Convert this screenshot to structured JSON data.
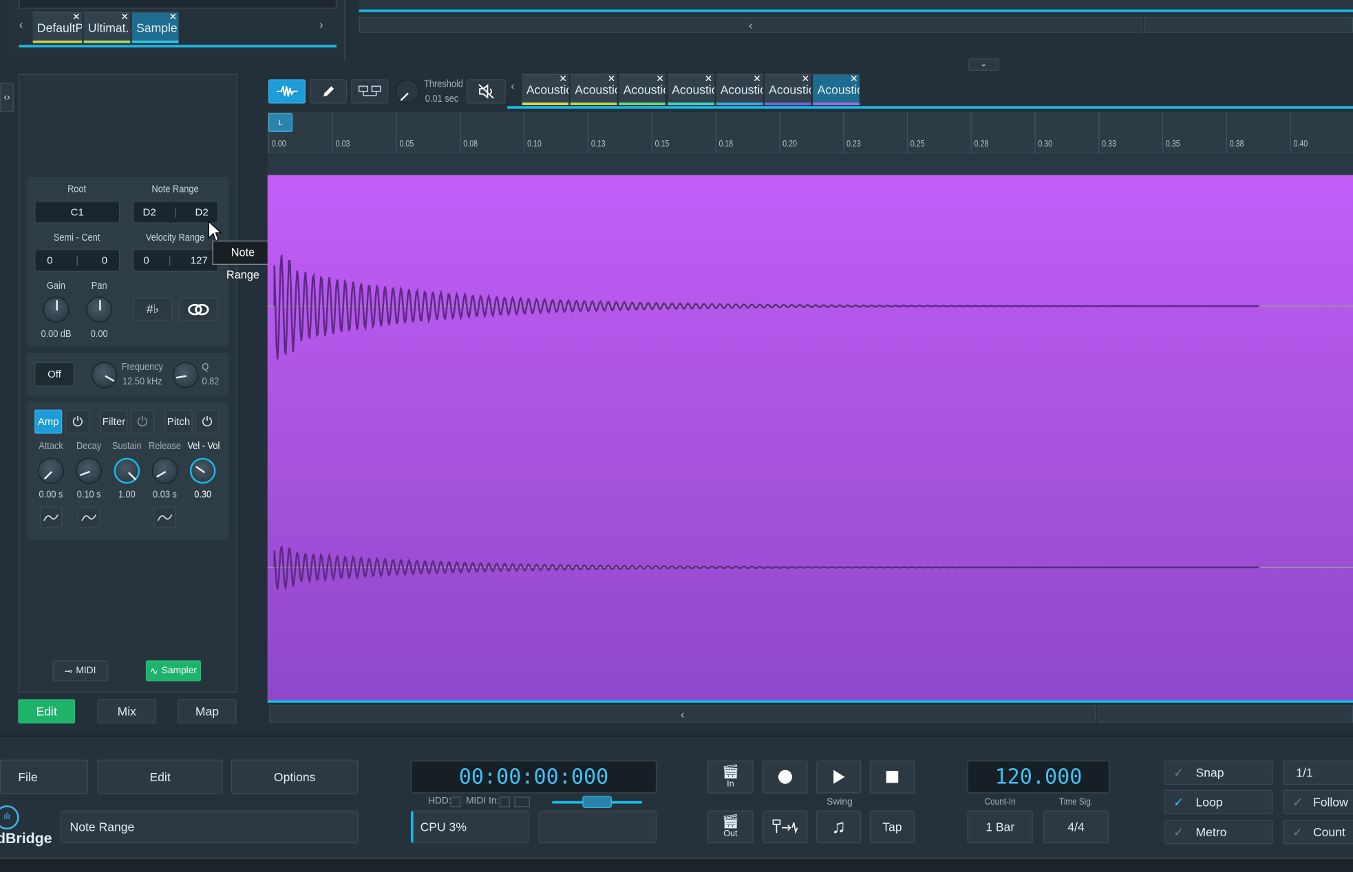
{
  "browser_tabs": [
    {
      "label": "DefaultP...",
      "color": "#c5d44a"
    },
    {
      "label": "Ultimat...",
      "color": "#a7d86a"
    },
    {
      "label": "Sample",
      "color": "#2fc2e8"
    }
  ],
  "toolbar": {
    "threshold_label": "Threshold",
    "threshold_value": "0.01 sec"
  },
  "sample_tabs": [
    {
      "label": "Acoustic...",
      "color": "#d8d64a"
    },
    {
      "label": "Acoustic...",
      "color": "#b6d84a"
    },
    {
      "label": "Acoustic...",
      "color": "#6ad87a"
    },
    {
      "label": "Acoustic...",
      "color": "#3fd8c6"
    },
    {
      "label": "Acoustic...",
      "color": "#3fa8e8"
    },
    {
      "label": "Acoustic...",
      "color": "#6a6ae8"
    },
    {
      "label": "Acoustic...",
      "color": "#a06ae8"
    }
  ],
  "ruler": {
    "loop_marker": "L",
    "ticks": [
      "0.00",
      "0.03",
      "0.05",
      "0.08",
      "0.10",
      "0.13",
      "0.15",
      "0.18",
      "0.20",
      "0.23",
      "0.25",
      "0.28",
      "0.30",
      "0.33",
      "0.35",
      "0.38",
      "0.40"
    ]
  },
  "zone": {
    "root_label": "Root",
    "root_value": "C1",
    "note_range_label": "Note Range",
    "note_low": "D2",
    "note_high": "D2",
    "semi_cent_label": "Semi - Cent",
    "semi": "0",
    "cent": "0",
    "velocity_label": "Velocity Range",
    "vel_low": "0",
    "vel_high": "127",
    "gain_label": "Gain",
    "gain_value": "0.00 dB",
    "pan_label": "Pan",
    "pan_value": "0.00",
    "sharp_flat_symbol": "#♭"
  },
  "tooltip": "Note Range",
  "filter": {
    "off_label": "Off",
    "freq_label": "Frequency",
    "freq_value": "12.50 kHz",
    "q_label": "Q",
    "q_value": "0.82"
  },
  "envelope": {
    "amp_label": "Amp",
    "filter_label": "Filter",
    "pitch_label": "Pitch",
    "attack_label": "Attack",
    "attack_value": "0.00 s",
    "decay_label": "Decay",
    "decay_value": "0.10 s",
    "sustain_label": "Sustain",
    "sustain_value": "1.00",
    "release_label": "Release",
    "release_value": "0.03 s",
    "velvol_label": "Vel - Vol",
    "velvol_value": "0.30"
  },
  "panel_buttons": {
    "midi": "MIDI",
    "sampler": "Sampler"
  },
  "mode_tabs": {
    "edit": "Edit",
    "mix": "Mix",
    "map": "Map"
  },
  "bottom": {
    "file": "File",
    "edit": "Edit",
    "options": "Options",
    "brand": "dBridge",
    "status": "Note Range",
    "time": "00:00:00:000",
    "hdd": "HDD:",
    "midi_in": "MIDI In:",
    "cpu": "CPU 3%",
    "in_label": "In",
    "out_label": "Out",
    "swing": "Swing",
    "tap": "Tap",
    "tempo": "120.000",
    "count_in_label": "Count-In",
    "count_in_value": "1 Bar",
    "timesig_label": "Time Sig.",
    "timesig_value": "4/4",
    "snap": "Snap",
    "loop": "Loop",
    "metro": "Metro",
    "quant": "1/1",
    "follow": "Follow",
    "count": "Count"
  },
  "colors": {
    "accent": "#19b8e6",
    "waveform_top": "#c05cf4",
    "waveform_bottom": "#8e47c6",
    "green": "#1fb26a"
  }
}
